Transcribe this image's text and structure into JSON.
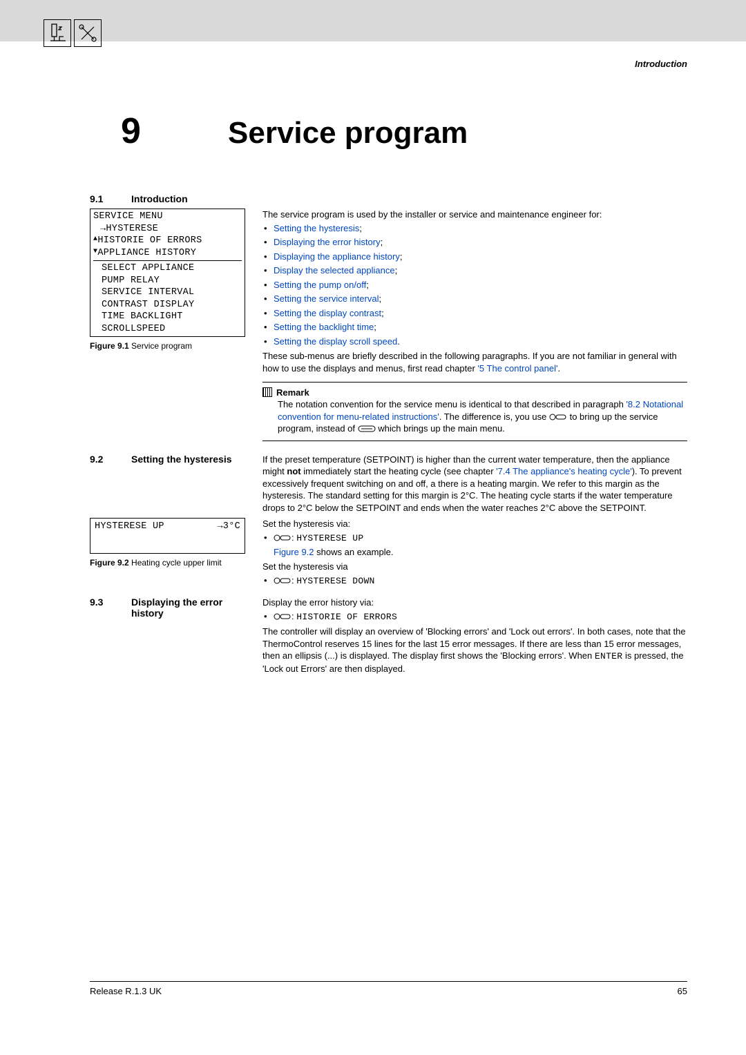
{
  "header": {
    "section": "Introduction"
  },
  "chapter": {
    "number": "9",
    "title": "Service program"
  },
  "sec9_1": {
    "num": "9.1",
    "title": "Introduction"
  },
  "lcd1": {
    "l1": "SERVICE MENU",
    "l2": "→HYSTERESE",
    "l3": " HISTORIE OF ERRORS",
    "l4": " APPLIANCE HISTORY",
    "s1": "SELECT APPLIANCE",
    "s2": "PUMP RELAY",
    "s3": "SERVICE INTERVAL",
    "s4": "CONTRAST DISPLAY",
    "s5": "TIME BACKLIGHT",
    "s6": "SCROLLSPEED"
  },
  "fig9_1": {
    "label": "Figure 9.1",
    "text": " Service program"
  },
  "intro_p1": "The service program is used by the installer or service and maintenance engineer for:",
  "intro_bullets": {
    "b1": "Setting the hysteresis",
    "b2": "Displaying the error history",
    "b3": "Displaying the appliance history",
    "b4": "Display the selected appliance",
    "b5": "Setting the pump on/off",
    "b6": "Setting the service interval",
    "b7": "Setting the display contrast",
    "b8": "Setting the backlight time",
    "b9": "Setting the display scroll speed"
  },
  "intro_p2a": "These sub-menus are briefly described in the following paragraphs. If you are not familiar in general with how to use the displays and menus, first read chapter ",
  "intro_p2_link": "'5 The control panel'",
  "intro_p2b": ".",
  "remark": {
    "title": "Remark",
    "b1": "The notation convention for the service menu is identical to that described in paragraph ",
    "link": "'8.2 Notational convention for menu-related instructions'",
    "b2": ". The difference is, you use ",
    "b3": " to bring up the service program, instead of ",
    "b4": " which brings up the main menu."
  },
  "sec9_2": {
    "num": "9.2",
    "title": "Setting the hysteresis"
  },
  "p9_2a": "If the preset temperature (SETPOINT) is higher than the current water temperature, then the appliance might ",
  "p9_2_not": "not",
  "p9_2b": " immediately start the heating cycle (see chapter ",
  "p9_2_link": "'7.4 The appliance's heating cycle'",
  "p9_2c": "). To prevent excessively frequent switching on and off, a there is a heating margin. We refer to this margin as the hysteresis. The standard setting for this margin is 2°C. The heating cycle starts if the water temperature drops to 2°C below the SETPOINT and ends when the water reaches 2°C above the SETPOINT.",
  "p9_2_set1": "Set the hysteresis via:",
  "p9_2_cmd1": "HYSTERESE UP",
  "p9_2_figref_a": "Figure 9.2",
  "p9_2_figref_b": " shows an example.",
  "p9_2_set2": "Set the hysteresis via",
  "p9_2_cmd2": "HYSTERESE DOWN",
  "hyst_box": {
    "left": "HYSTERESE UP",
    "right": "→3°C"
  },
  "fig9_2": {
    "label": "Figure 9.2",
    "text": " Heating cycle upper limit"
  },
  "sec9_3": {
    "num": "9.3",
    "title": "Displaying the error history"
  },
  "p9_3_a": "Display the error history via:",
  "p9_3_cmd": "HISTORIE OF ERRORS",
  "p9_3_b1": "The controller will display an overview of 'Blocking errors' and 'Lock out errors'. In both cases, note that the ThermoControl reserves 15 lines for the last 15 error messages. If there are less than 15 error messages, then an ellipsis (...) is displayed. The display first shows the 'Blocking errors'. When ",
  "p9_3_enter": "ENTER",
  "p9_3_b2": " is pressed, the 'Lock out Errors' are then displayed.",
  "footer": {
    "left": "Release R.1.3 UK",
    "right": "65"
  }
}
